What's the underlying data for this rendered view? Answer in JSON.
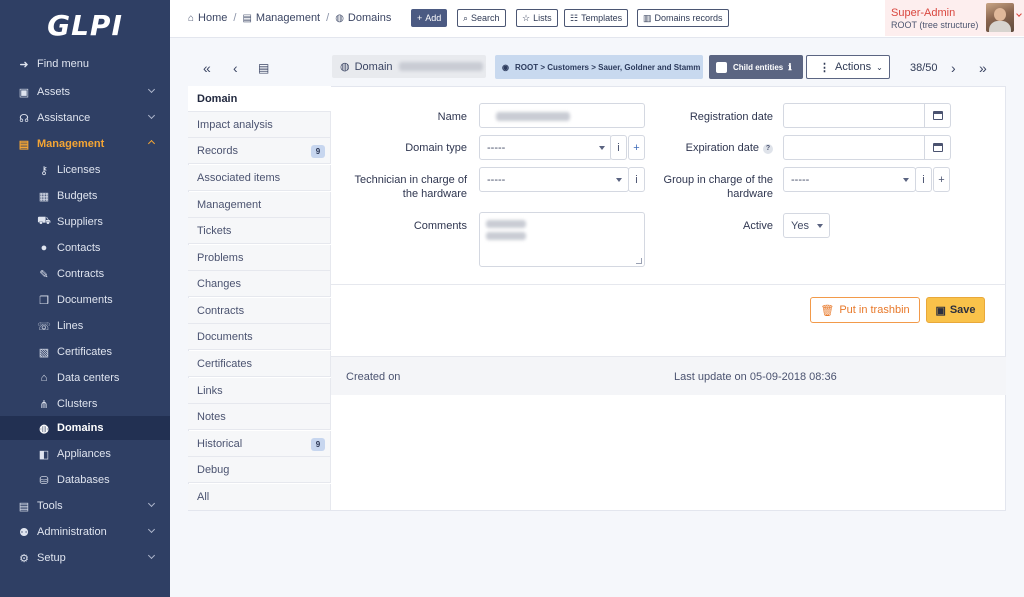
{
  "app": {
    "logo": "GLPI"
  },
  "sidebar": {
    "find_menu": "Find menu",
    "items": [
      {
        "label": "Assets",
        "icon": "box-icon"
      },
      {
        "label": "Assistance",
        "icon": "headset-icon"
      },
      {
        "label": "Management",
        "icon": "briefcase-icon"
      },
      {
        "label": "Tools",
        "icon": "briefcase-icon"
      },
      {
        "label": "Administration",
        "icon": "user-cog-icon"
      },
      {
        "label": "Setup",
        "icon": "gear-icon"
      }
    ],
    "management_sub": [
      {
        "label": "Licenses",
        "icon": "key-icon"
      },
      {
        "label": "Budgets",
        "icon": "calculator-icon"
      },
      {
        "label": "Suppliers",
        "icon": "dolly-icon"
      },
      {
        "label": "Contacts",
        "icon": "user-icon"
      },
      {
        "label": "Contracts",
        "icon": "contract-icon"
      },
      {
        "label": "Documents",
        "icon": "files-icon"
      },
      {
        "label": "Lines",
        "icon": "phone-icon"
      },
      {
        "label": "Certificates",
        "icon": "certificate-icon"
      },
      {
        "label": "Data centers",
        "icon": "building-icon"
      },
      {
        "label": "Clusters",
        "icon": "cluster-icon"
      },
      {
        "label": "Domains",
        "icon": "globe-icon"
      },
      {
        "label": "Appliances",
        "icon": "appliance-icon"
      },
      {
        "label": "Databases",
        "icon": "database-icon"
      }
    ]
  },
  "header": {
    "breadcrumb": [
      "Home",
      "Management",
      "Domains"
    ],
    "buttons": {
      "add": "Add",
      "search": "Search",
      "lists": "Lists",
      "templates": "Templates",
      "domains_records": "Domains records"
    },
    "user": {
      "name": "Super-Admin",
      "entity": "ROOT (tree structure)"
    }
  },
  "toolbar": {
    "item_type": "Domain",
    "entity_path": "ROOT > Customers > Sauer, Goldner and Stamm",
    "child_entities": "Child entities",
    "actions": "Actions",
    "pager": "38/50"
  },
  "tabs": [
    {
      "label": "Domain"
    },
    {
      "label": "Impact analysis"
    },
    {
      "label": "Records",
      "badge": "9"
    },
    {
      "label": "Associated items"
    },
    {
      "label": "Management"
    },
    {
      "label": "Tickets"
    },
    {
      "label": "Problems"
    },
    {
      "label": "Changes"
    },
    {
      "label": "Contracts"
    },
    {
      "label": "Documents"
    },
    {
      "label": "Certificates"
    },
    {
      "label": "Links"
    },
    {
      "label": "Notes"
    },
    {
      "label": "Historical",
      "badge": "9"
    },
    {
      "label": "Debug"
    },
    {
      "label": "All"
    }
  ],
  "form": {
    "name_label": "Name",
    "domain_type_label": "Domain type",
    "domain_type_value": "-----",
    "tech_label_1": "Technician in charge of",
    "tech_label_2": "the hardware",
    "tech_value": "-----",
    "comments_label": "Comments",
    "registration_label": "Registration date",
    "expiration_label": "Expiration date",
    "group_label_1": "Group in charge of the",
    "group_label_2": "hardware",
    "group_value": "-----",
    "active_label": "Active",
    "active_value": "Yes"
  },
  "buttons": {
    "trash": "Put in trashbin",
    "save": "Save"
  },
  "footer": {
    "created_on": "Created on",
    "last_update": "Last update on 05-09-2018 08:36"
  }
}
